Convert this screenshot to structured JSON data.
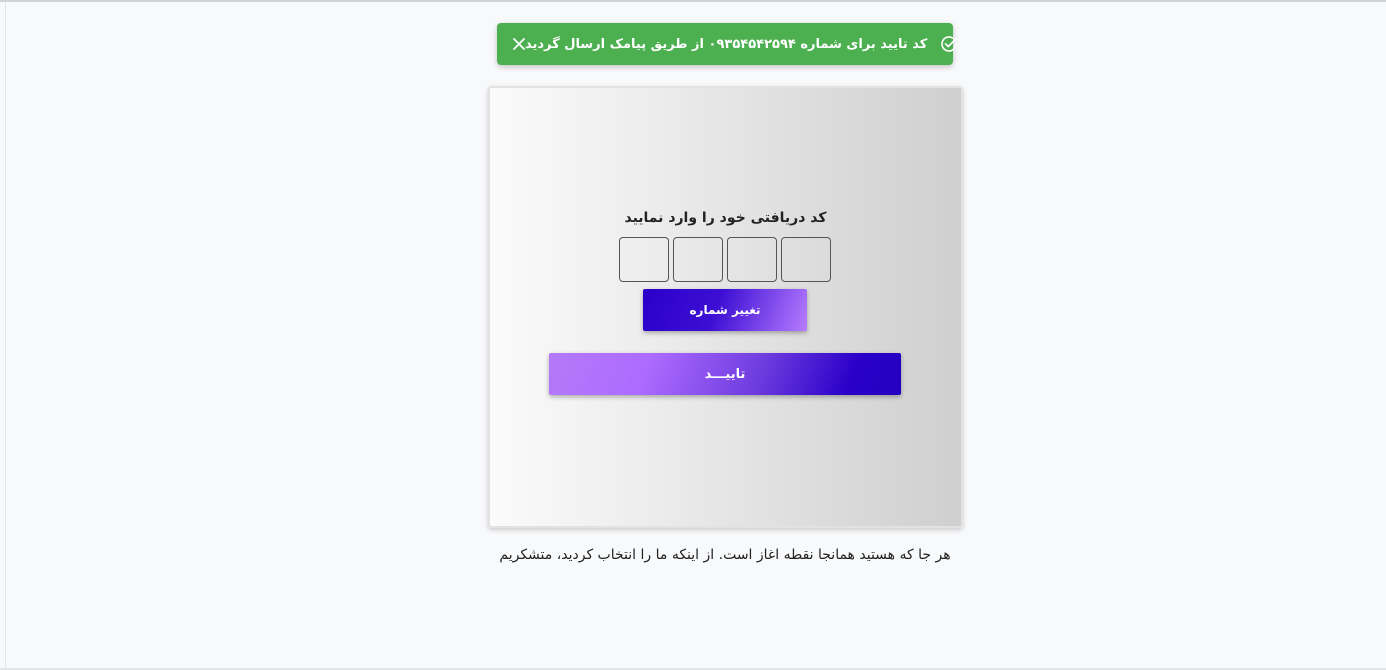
{
  "toast": {
    "message": "کد تایید برای شماره ۰۹۳۵۴۵۴۲۵۹۴ از طریق پیامک ارسال گردید",
    "close_icon": "close-icon",
    "status_icon": "check-circle-icon",
    "color": "#4caf50"
  },
  "card": {
    "title": "کد دریافتی خود را وارد نمایید",
    "code_digits": [
      "",
      "",
      "",
      ""
    ],
    "change_number_label": "تغییر شماره",
    "confirm_label": "تاییـــد"
  },
  "footer": {
    "text": "هر جا که هستید همانجا نقطه اغاز است. از اینکه ما را انتخاب کردید، متشکریم"
  },
  "colors": {
    "accent_dark": "#2a00c9",
    "accent_light": "#ad6bff",
    "success": "#4caf50"
  }
}
